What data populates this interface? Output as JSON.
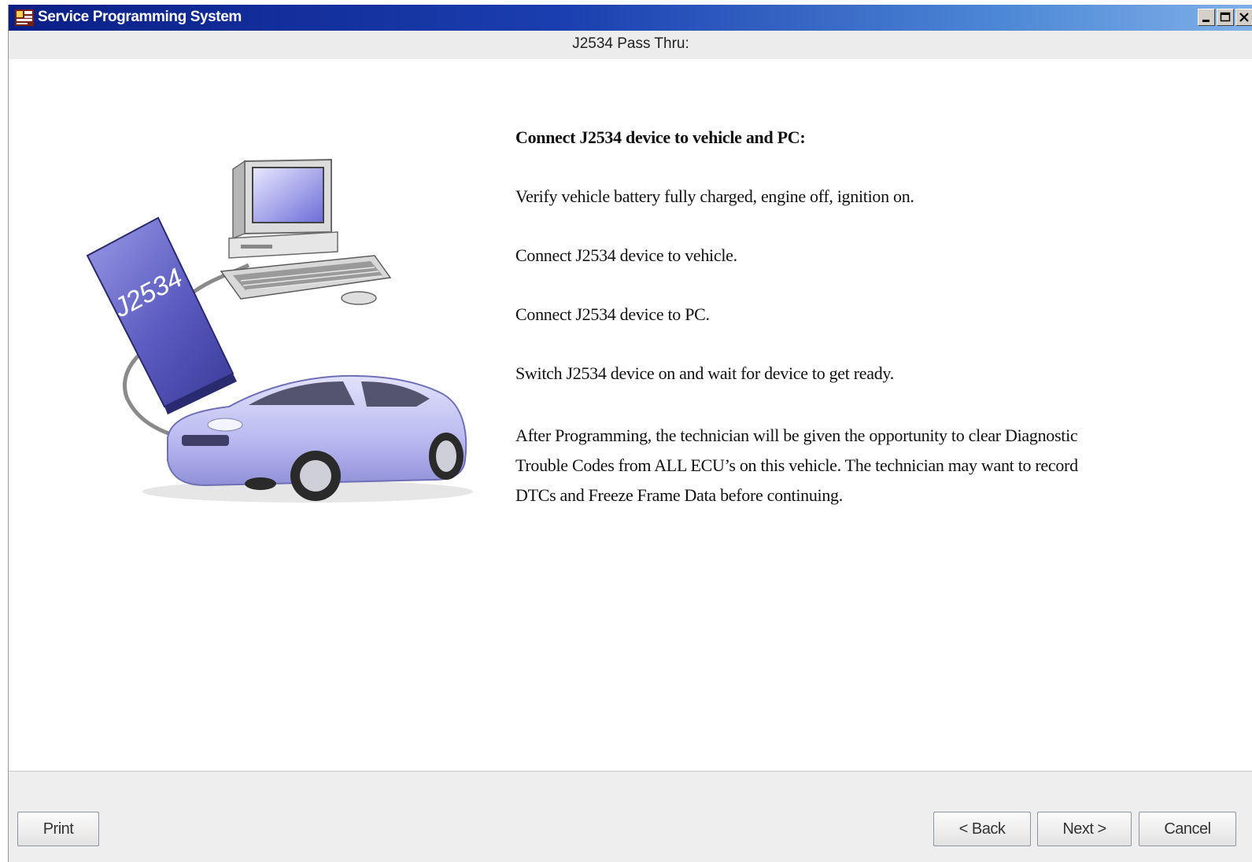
{
  "window": {
    "title": "Service Programming System",
    "subtitle": "J2534 Pass Thru:"
  },
  "titlebar_icons": [
    "app-icon",
    "minimize-icon",
    "maximize-icon",
    "close-icon"
  ],
  "illustration": {
    "device_label": "J2534"
  },
  "instructions": {
    "heading": "Connect J2534 device to vehicle and PC:",
    "steps": [
      "Verify vehicle battery fully charged, engine off, ignition on.",
      "Connect J2534 device to vehicle.",
      "Connect J2534 device to PC.",
      "Switch J2534 device on and wait for device to get ready."
    ],
    "note": "After Programming, the technician will be given the opportunity to clear Diagnostic Trouble Codes from ALL ECU’s on this vehicle. The technician may want to record DTCs and Freeze Frame Data before continuing."
  },
  "buttons": {
    "print": "Print",
    "back": "< Back",
    "next": "Next >",
    "cancel": "Cancel"
  },
  "colors": {
    "titlebar_start": "#0a1f86",
    "titlebar_end": "#7fb0e8",
    "panel": "#eeeeee",
    "device": "#6a6ac8",
    "car": "#c8c8f4"
  }
}
